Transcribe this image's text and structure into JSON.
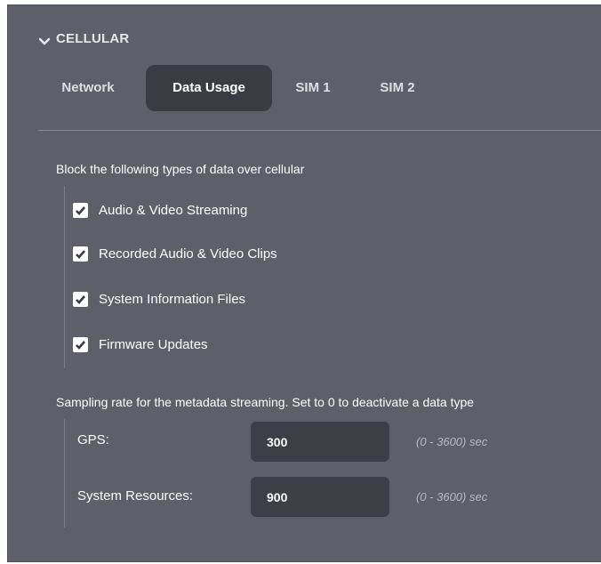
{
  "section": {
    "title": "CELLULAR",
    "toggle_icon": "chevron-down-icon"
  },
  "tabs": [
    {
      "label": "Network",
      "active": false
    },
    {
      "label": "Data Usage",
      "active": true
    },
    {
      "label": "SIM 1",
      "active": false
    },
    {
      "label": "SIM 2",
      "active": false
    }
  ],
  "block": {
    "heading": "Block the following types of data over cellular",
    "items": [
      {
        "label": "Audio & Video Streaming",
        "checked": true
      },
      {
        "label": "Recorded Audio & Video Clips",
        "checked": true
      },
      {
        "label": "System Information Files",
        "checked": true
      },
      {
        "label": "Firmware Updates",
        "checked": true
      }
    ]
  },
  "sampling": {
    "heading": "Sampling rate for the metadata streaming. Set to 0 to deactivate a data type",
    "fields": [
      {
        "label": "GPS:",
        "value": "300",
        "range": "(0 - 3600) sec"
      },
      {
        "label": "System Resources:",
        "value": "900",
        "range": "(0 - 3600) sec"
      }
    ]
  },
  "colors": {
    "panel_bg": "#5f5f69",
    "active_tab_bg": "#3b3b43",
    "input_bg": "#3e3e46"
  }
}
